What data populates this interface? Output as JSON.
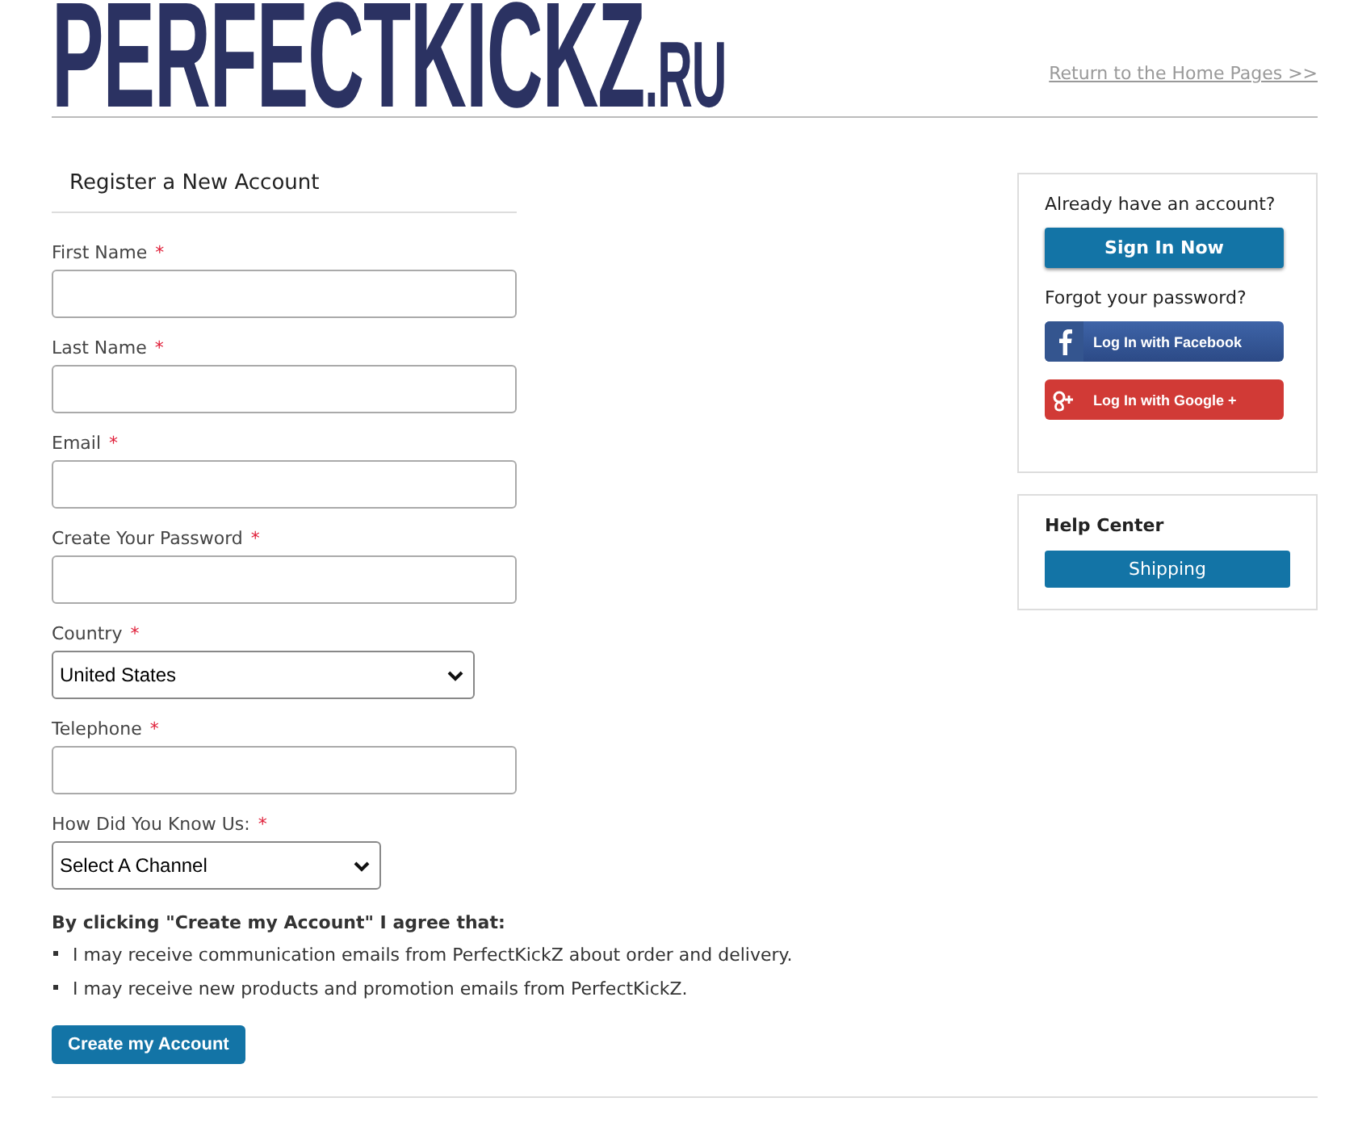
{
  "header": {
    "logo": {
      "main": "PERFECTKICKZ",
      "suffix": ".RU"
    },
    "home_link": "Return to the Home Pages >>"
  },
  "form": {
    "title": "Register a New Account",
    "fields": [
      {
        "kind": "text",
        "label": "First Name",
        "required_mark": "*"
      },
      {
        "kind": "text",
        "label": "Last Name",
        "required_mark": "*"
      },
      {
        "kind": "text",
        "label": "Email",
        "required_mark": "*"
      },
      {
        "kind": "text",
        "label": "Create Your Password",
        "required_mark": "*"
      },
      {
        "kind": "select",
        "label": "Country",
        "required_mark": "*",
        "value": "United States"
      },
      {
        "kind": "text",
        "label": "Telephone",
        "required_mark": "*"
      },
      {
        "kind": "select",
        "label": "How Did You Know Us:",
        "required_mark": "*",
        "value": "Select A Channel"
      }
    ],
    "agreement": {
      "heading": "By clicking \"Create my Account\" I agree that:",
      "items": [
        "I may receive communication emails from PerfectKickZ about order and delivery.",
        "I may receive new products and promotion emails from PerfectKickZ."
      ]
    },
    "submit": "Create my Account"
  },
  "sidebar": {
    "account": {
      "prompt": "Already have an account?",
      "sign_in": "Sign In Now",
      "forgot": "Forgot your password?",
      "social": [
        {
          "kind": "facebook",
          "label": "Log In with Facebook"
        },
        {
          "kind": "google",
          "label": "Log In with Google +"
        }
      ]
    },
    "help": {
      "title": "Help Center",
      "buttons": [
        "Shipping"
      ]
    }
  }
}
